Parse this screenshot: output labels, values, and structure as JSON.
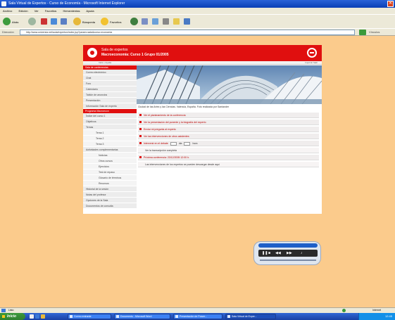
{
  "window": {
    "title": "Sala Virtual de Expertos - Curso de Economía - Microsoft Internet Explorer",
    "close_glyph": "✕"
  },
  "menu": [
    "Archivo",
    "Edición",
    "Ver",
    "Favoritos",
    "Herramientas",
    "Ayuda"
  ],
  "toolbar": {
    "back_label": "Atrás",
    "search_label": "Búsqueda",
    "favorites_label": "Favoritos",
    "icons": [
      "back-icon",
      "forward-icon",
      "stop-icon",
      "refresh-icon",
      "home-icon",
      "search-icon",
      "favorites-icon",
      "media-icon",
      "history-icon",
      "mail-icon",
      "print-icon",
      "edit-icon",
      "folder-icon"
    ]
  },
  "address": {
    "label": "Dirección",
    "url": "http://www.universia.net/aula/expertos/index.jsp?param=sala&curso=economia",
    "go_label": "Ir",
    "links_label": "Vínculos"
  },
  "site": {
    "title": "Sala de expertos",
    "subtitle": "Macroeconomía: Curso 1 Grupo 01/2005",
    "home_link": "Inicio • Ayuda",
    "top_right": "Imprimir  Salir",
    "caption": "Ciudad de las Artes y las Ciencias. Valencia, España. Foto realizada por Santander"
  },
  "sidebar": {
    "section1": "Sala de conferencias",
    "items1": [
      "Correo electrónico",
      "Chat",
      "Foro",
      "Calendario",
      "Tablón de anuncios",
      "Presentación",
      "Información Sala de experto"
    ],
    "section2": "Programa Macroecon",
    "items2": [
      "Índice del curso 1",
      "Objetivos",
      "Temas"
    ],
    "topics": [
      "Tema 1",
      "Tema 2",
      "Tema 3"
    ],
    "group_label": "Actividades complementarias",
    "subitems": [
      "Noticias",
      "Otros cursos",
      "Ejercicios",
      "Test de repaso",
      "Glosario de términos",
      "Recursos"
    ],
    "tail_items": [
      "Historial de la sesión",
      "Notas del profesor",
      "Opciones de la Sala",
      "Documentos de consulta"
    ]
  },
  "questions": [
    "Ver el planteamiento de la conferencia",
    "Ver la presentación del ponente y la biografía del experto",
    "Enviar mi pregunta al experto",
    "Ver las intervenciones de otros asistentes"
  ],
  "date_row": {
    "label": "Intervenir en el debate",
    "select_a": "dia",
    "select_b": "hora"
  },
  "plain_row": "Ver la transcripción completa",
  "last_row": "Próxima conferencia: 23/12/2005 12:00 h.",
  "footer_row": "Las intervenciones de los expertos se pueden descargar desde aquí",
  "player": {
    "play": "▶",
    "stop": "■",
    "prev": "◀◀",
    "next": "▶▶",
    "mute": "♪"
  },
  "status": {
    "done": "Listo",
    "zone": "Internet"
  },
  "taskbar": {
    "start": "Inicio",
    "tasks": [
      "Correo entrante",
      "Documento - Microsoft Word",
      "Presentación de Power...",
      "Sala Virtual de Exper..."
    ],
    "clock": "12:45"
  },
  "colors": {
    "brand_red": "#e00f0f",
    "page_background": "#fbcb8c",
    "xp_blue": "#0a3fb5"
  }
}
